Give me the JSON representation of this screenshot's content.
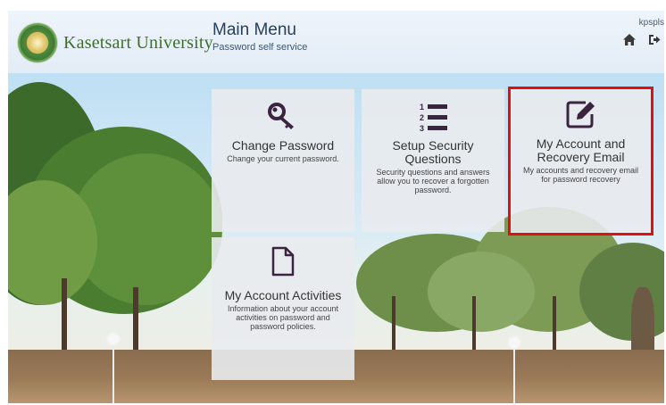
{
  "brand": {
    "name": "Kasetsart University"
  },
  "header": {
    "title": "Main Menu",
    "subtitle": "Password self service",
    "user": "kpspls"
  },
  "icons": {
    "home": "home-icon",
    "logout": "sign-out-icon"
  },
  "tiles": [
    {
      "title": "Change Password",
      "desc": "Change your current password.",
      "icon": "key-icon"
    },
    {
      "title": "Setup Security Questions",
      "desc": "Security questions and answers allow you to recover a forgotten password.",
      "icon": "numbered-list-icon"
    },
    {
      "title": "My Account and Recovery Email",
      "desc": "My accounts and recovery email for password recovery",
      "icon": "edit-icon"
    },
    {
      "title": "My Account Activities",
      "desc": "Information about your account activities on password and password policies.",
      "icon": "document-icon"
    }
  ],
  "colors": {
    "icon": "#3b2440",
    "highlight": "#e01010",
    "brand": "#3f6f2c"
  }
}
